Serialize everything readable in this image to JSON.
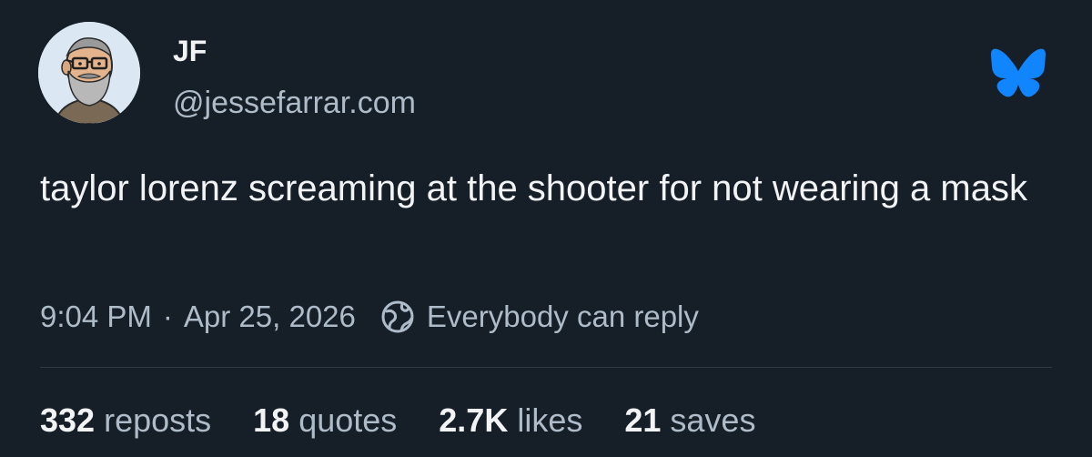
{
  "author": {
    "display_name": "JF",
    "handle": "@jessefarrar.com",
    "avatar": "bearded-man-glasses-illustration"
  },
  "logo": "bluesky-butterfly-icon",
  "post": {
    "text": "taylor lorenz screaming at the shooter for not wearing a mask",
    "time": "9:04 PM",
    "separator": "·",
    "date": "Apr 25, 2026",
    "reply_icon": "globe-icon",
    "reply_setting": "Everybody can reply"
  },
  "stats": [
    {
      "count": "332",
      "label": "reposts"
    },
    {
      "count": "18",
      "label": "quotes"
    },
    {
      "count": "2.7K",
      "label": "likes"
    },
    {
      "count": "21",
      "label": "saves"
    }
  ],
  "colors": {
    "background": "#161e27",
    "text": "#f1f3f5",
    "muted": "#aebbc9",
    "brand": "#1185fe"
  }
}
